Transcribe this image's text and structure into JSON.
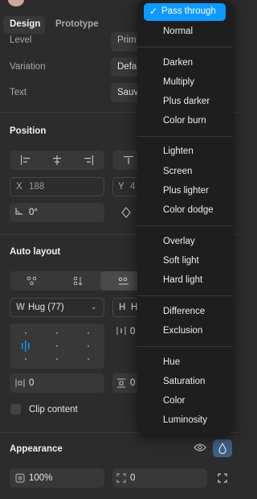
{
  "tabs": [
    "Design",
    "Prototype"
  ],
  "props": {
    "level_label": "Level",
    "level_value": "Prim",
    "variation_label": "Variation",
    "variation_value": "Defa",
    "text_label": "Text",
    "text_value": "Sauv"
  },
  "position": {
    "title": "Position",
    "x_label": "X",
    "x_value": "188",
    "y_label": "Y",
    "y_value": "4",
    "rotation": "0°"
  },
  "auto_layout": {
    "title": "Auto layout",
    "w_label": "W",
    "w_value": "Hug (77)",
    "h_label": "H",
    "h_value": "H",
    "gap": "0",
    "padding_h": "0",
    "padding_v": "0",
    "clip_content": "Clip content"
  },
  "appearance": {
    "title": "Appearance",
    "opacity": "100%",
    "radius": "0"
  },
  "blend_menu": {
    "selected": "Pass through",
    "groups": [
      [
        "Normal"
      ],
      [
        "Darken",
        "Multiply",
        "Plus darker",
        "Color burn"
      ],
      [
        "Lighten",
        "Screen",
        "Plus lighter",
        "Color dodge"
      ],
      [
        "Overlay",
        "Soft light",
        "Hard light"
      ],
      [
        "Difference",
        "Exclusion"
      ],
      [
        "Hue",
        "Saturation",
        "Color",
        "Luminosity"
      ]
    ]
  },
  "colors": {
    "accent": "#0d99ff",
    "panel": "#2c2c2c",
    "menu": "#1e1e1e"
  }
}
